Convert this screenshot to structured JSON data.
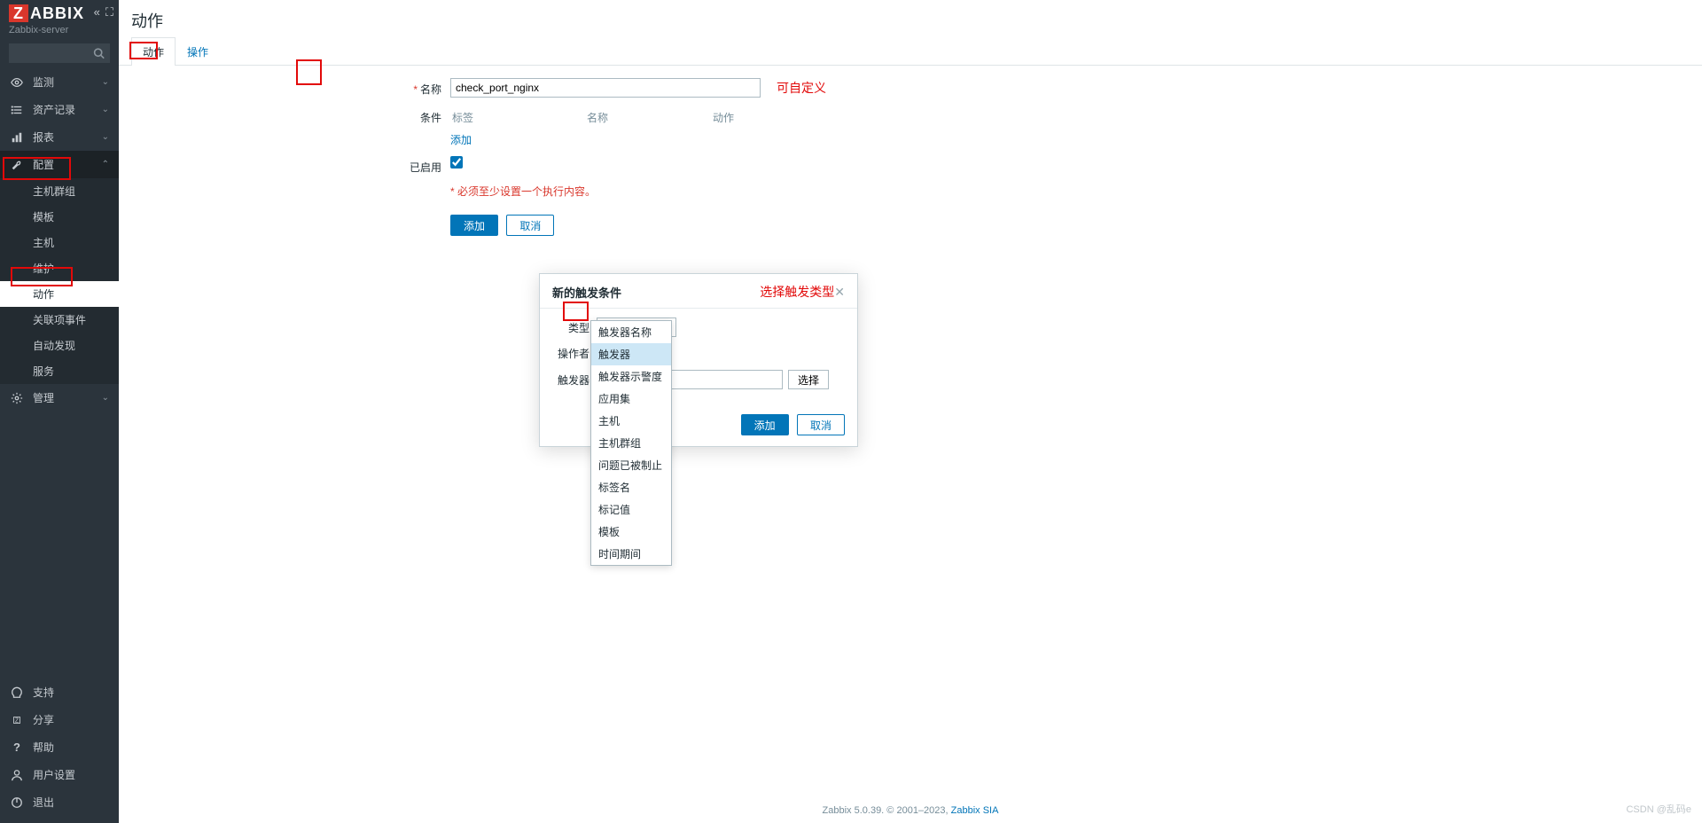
{
  "sidebar": {
    "logo_prefix": "Z",
    "logo_rest": "ABBIX",
    "server_name": "Zabbix-server",
    "nav": [
      {
        "id": "monitoring",
        "label": "监测",
        "icon": "eye"
      },
      {
        "id": "inventory",
        "label": "资产记录",
        "icon": "list"
      },
      {
        "id": "reports",
        "label": "报表",
        "icon": "chart"
      },
      {
        "id": "config",
        "label": "配置",
        "icon": "wrench",
        "expanded": true
      }
    ],
    "config_sub": [
      {
        "id": "hostgroups",
        "label": "主机群组"
      },
      {
        "id": "templates",
        "label": "模板"
      },
      {
        "id": "hosts",
        "label": "主机"
      },
      {
        "id": "maintenance",
        "label": "维护"
      },
      {
        "id": "actions",
        "label": "动作",
        "active": true
      },
      {
        "id": "eventcorr",
        "label": "关联项事件"
      },
      {
        "id": "discovery",
        "label": "自动发现"
      },
      {
        "id": "services",
        "label": "服务"
      }
    ],
    "admin": {
      "label": "管理"
    },
    "bottom": [
      {
        "id": "support",
        "label": "支持"
      },
      {
        "id": "share",
        "label": "分享"
      },
      {
        "id": "help",
        "label": "帮助"
      },
      {
        "id": "usersettings",
        "label": "用户设置"
      },
      {
        "id": "logout",
        "label": "退出"
      }
    ]
  },
  "page": {
    "title": "动作",
    "tabs": [
      {
        "id": "action",
        "label": "动作",
        "active": true
      },
      {
        "id": "operations",
        "label": "操作"
      }
    ]
  },
  "form": {
    "name_label": "名称",
    "name_value": "check_port_nginx",
    "conditions_label": "条件",
    "cond_cols": {
      "tag": "标签",
      "name": "名称",
      "action": "动作"
    },
    "add_link": "添加",
    "enabled_label": "已启用",
    "hint": "必须至少设置一个执行内容。",
    "btn_add": "添加",
    "btn_cancel": "取消"
  },
  "annotations": {
    "name_hint": "可自定义",
    "type_hint": "选择触发类型"
  },
  "modal": {
    "title": "新的触发条件",
    "rows": {
      "type_label": "类型",
      "type_selected": "触发器",
      "operator_label": "操作者",
      "trigger_label": "触发器",
      "select_btn": "选择"
    },
    "btn_add": "添加",
    "btn_cancel": "取消"
  },
  "dropdown": {
    "options": [
      "触发器名称",
      "触发器",
      "触发器示警度",
      "应用集",
      "主机",
      "主机群组",
      "问题已被制止",
      "标签名",
      "标记值",
      "模板",
      "时间期间"
    ],
    "highlighted": "触发器"
  },
  "footer": {
    "text_prefix": "Zabbix 5.0.39. © 2001–2023, ",
    "link": "Zabbix SIA"
  },
  "watermark": "CSDN @乱码e"
}
